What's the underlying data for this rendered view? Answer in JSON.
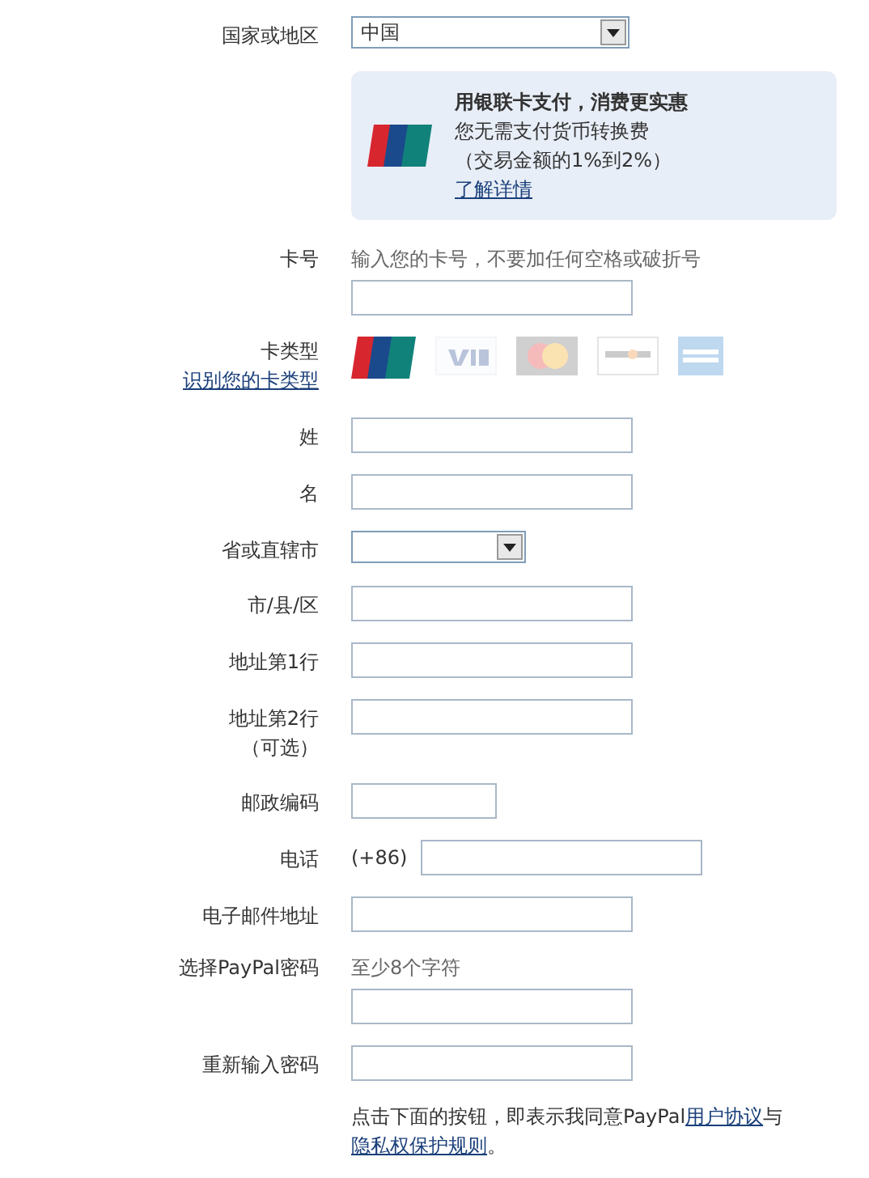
{
  "country": {
    "label": "国家或地区",
    "value": "中国"
  },
  "promo": {
    "title": "用银联卡支付，消费更实惠",
    "lines": [
      "您无需支付货币转换费",
      "（交易金额的1%到2%）"
    ],
    "link": "了解详情"
  },
  "fields": [
    {
      "kind": "input",
      "label": "卡号",
      "hint": "输入您的卡号，不要加任何空格或破折号"
    },
    {
      "kind": "card_types",
      "label": "卡类型",
      "link": "识别您的卡类型",
      "cards": [
        {
          "kind": "unionpay",
          "selected": true
        },
        {
          "kind": "visa",
          "selected": false
        },
        {
          "kind": "mastercard",
          "selected": false
        },
        {
          "kind": "discover",
          "selected": false
        },
        {
          "kind": "amex",
          "selected": false
        }
      ]
    },
    {
      "kind": "input",
      "label": "姓"
    },
    {
      "kind": "input",
      "label": "名"
    },
    {
      "kind": "select",
      "label": "省或直辖市"
    },
    {
      "kind": "input",
      "label": "市/县/区"
    },
    {
      "kind": "input",
      "label": "地址第1行"
    },
    {
      "kind": "input",
      "label": "地址第2行",
      "note": "（可选）"
    },
    {
      "kind": "short_input",
      "label": "邮政编码"
    },
    {
      "kind": "phone",
      "label": "电话",
      "prefix": "(+86)"
    },
    {
      "kind": "input",
      "label": "电子邮件地址"
    },
    {
      "kind": "input",
      "label": "选择PayPal密码",
      "hint": "至少8个字符"
    },
    {
      "kind": "input",
      "label": "重新输入密码"
    }
  ],
  "terms": [
    {
      "text": "点击下面的按钮，即表示我同意PayPal",
      "link": false
    },
    {
      "text": "用户协议",
      "link": true
    },
    {
      "text": "与",
      "link": false
    },
    {
      "text": "隐私权保护规则",
      "link": true
    },
    {
      "text": "。",
      "link": false
    }
  ]
}
